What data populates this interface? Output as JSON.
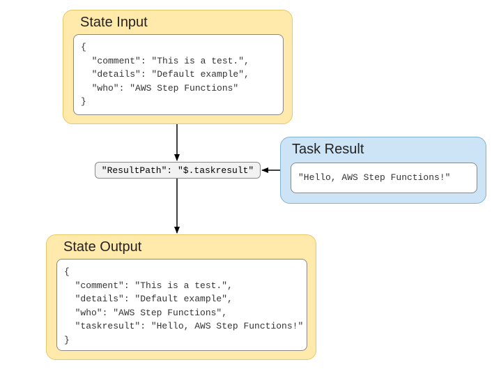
{
  "titles": {
    "stateInput": "State Input",
    "taskResult": "Task Result",
    "stateOutput": "State Output"
  },
  "resultPathExpr": "\"ResultPath\": \"$.taskresult\"",
  "taskResultValue": "\"Hello, AWS Step Functions!\"",
  "stateInputCode": "{\n  \"comment\": \"This is a test.\",\n  \"details\": \"Default example\",\n  \"who\": \"AWS Step Functions\"\n}",
  "stateOutputCode": "{\n  \"comment\": \"This is a test.\",\n  \"details\": \"Default example\",\n  \"who\": \"AWS Step Functions\",\n  \"taskresult\": \"Hello, AWS Step Functions!\"\n}",
  "chart_data": {
    "type": "diagram",
    "title": "AWS Step Functions ResultPath behavior",
    "nodes": [
      {
        "id": "state-input",
        "label": "State Input",
        "kind": "container",
        "content": {
          "comment": "This is a test.",
          "details": "Default example",
          "who": "AWS Step Functions"
        }
      },
      {
        "id": "result-path",
        "label": "\"ResultPath\": \"$.taskresult\"",
        "kind": "operator"
      },
      {
        "id": "task-result",
        "label": "Task Result",
        "kind": "container",
        "content": "Hello, AWS Step Functions!"
      },
      {
        "id": "state-output",
        "label": "State Output",
        "kind": "container",
        "content": {
          "comment": "This is a test.",
          "details": "Default example",
          "who": "AWS Step Functions",
          "taskresult": "Hello, AWS Step Functions!"
        }
      }
    ],
    "edges": [
      {
        "from": "state-input",
        "to": "result-path"
      },
      {
        "from": "task-result",
        "to": "result-path"
      },
      {
        "from": "result-path",
        "to": "state-output"
      }
    ]
  }
}
